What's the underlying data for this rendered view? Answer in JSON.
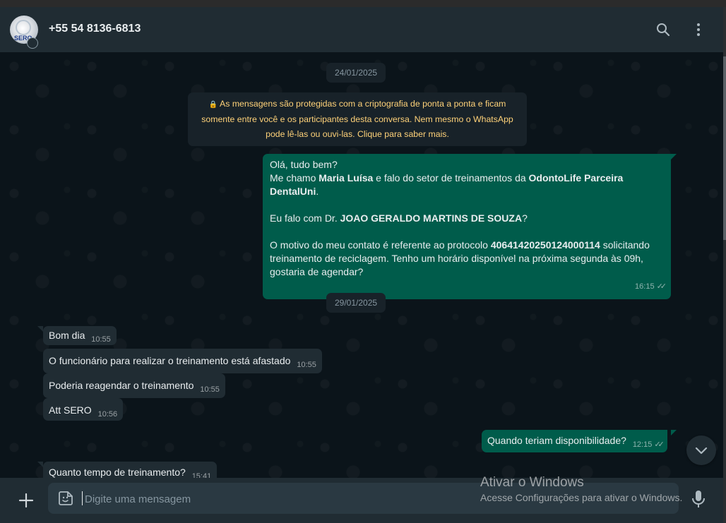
{
  "header": {
    "contact": "+55 54 8136-6813",
    "avatar_label": "SERO",
    "search_icon": "search-icon",
    "menu_icon": "kebab-menu-icon"
  },
  "chat": {
    "date1": "24/01/2025",
    "encryption_notice": "As mensagens são protegidas com a criptografia de ponta a ponta e ficam somente entre você e os participantes desta conversa. Nem mesmo o WhatsApp pode lê-las ou ouvi-las. Clique para saber mais.",
    "outgoing_long": {
      "l1": "Olá, tudo bem?",
      "l2a": "Me chamo ",
      "name": "Maria Luísa",
      "l2b": " e falo do setor de treinamentos da ",
      "company": "OdontoLife Parceira DentalUni",
      "l2c": ".",
      "l3a": "Eu falo com Dr. ",
      "doctor": "JOAO GERALDO MARTINS DE SOUZA",
      "l3b": "?",
      "l4a": "O motivo do meu contato é referente ao protocolo ",
      "protocol": "4064142025012400011",
      "l4b": "4",
      "l4c": " solicitando treinamento de reciclagem. Tenho um horário disponível na próxima segunda às 09h, gostaria de agendar?",
      "time": "16:15"
    },
    "date2": "29/01/2025",
    "incoming": [
      {
        "text": "Bom dia",
        "time": "10:55"
      },
      {
        "text": "O funcionário para realizar o treinamento está afastado",
        "time": "10:55"
      },
      {
        "text": "Poderia reagendar o treinamento",
        "time": "10:55"
      },
      {
        "text": "Att SERO",
        "time": "10:56"
      }
    ],
    "outgoing_short": {
      "text": "Quando teriam disponibilidade?",
      "time": "12:15"
    },
    "incoming_partial": {
      "text": "Quanto tempo de treinamento?",
      "time": "15:41"
    }
  },
  "footer": {
    "placeholder": "Digite uma mensagem",
    "attach_icon": "plus-icon",
    "sticker_icon": "sticker-icon",
    "mic_icon": "microphone-icon"
  },
  "watermark": {
    "title": "Ativar o Windows",
    "subtitle": "Acesse Configurações para ativar o Windows."
  },
  "colors": {
    "header_bg": "#202c33",
    "chat_bg": "#0b141a",
    "outgoing_bubble": "#005c4b",
    "incoming_bubble": "#202c33",
    "notice_text": "#ffd279"
  }
}
